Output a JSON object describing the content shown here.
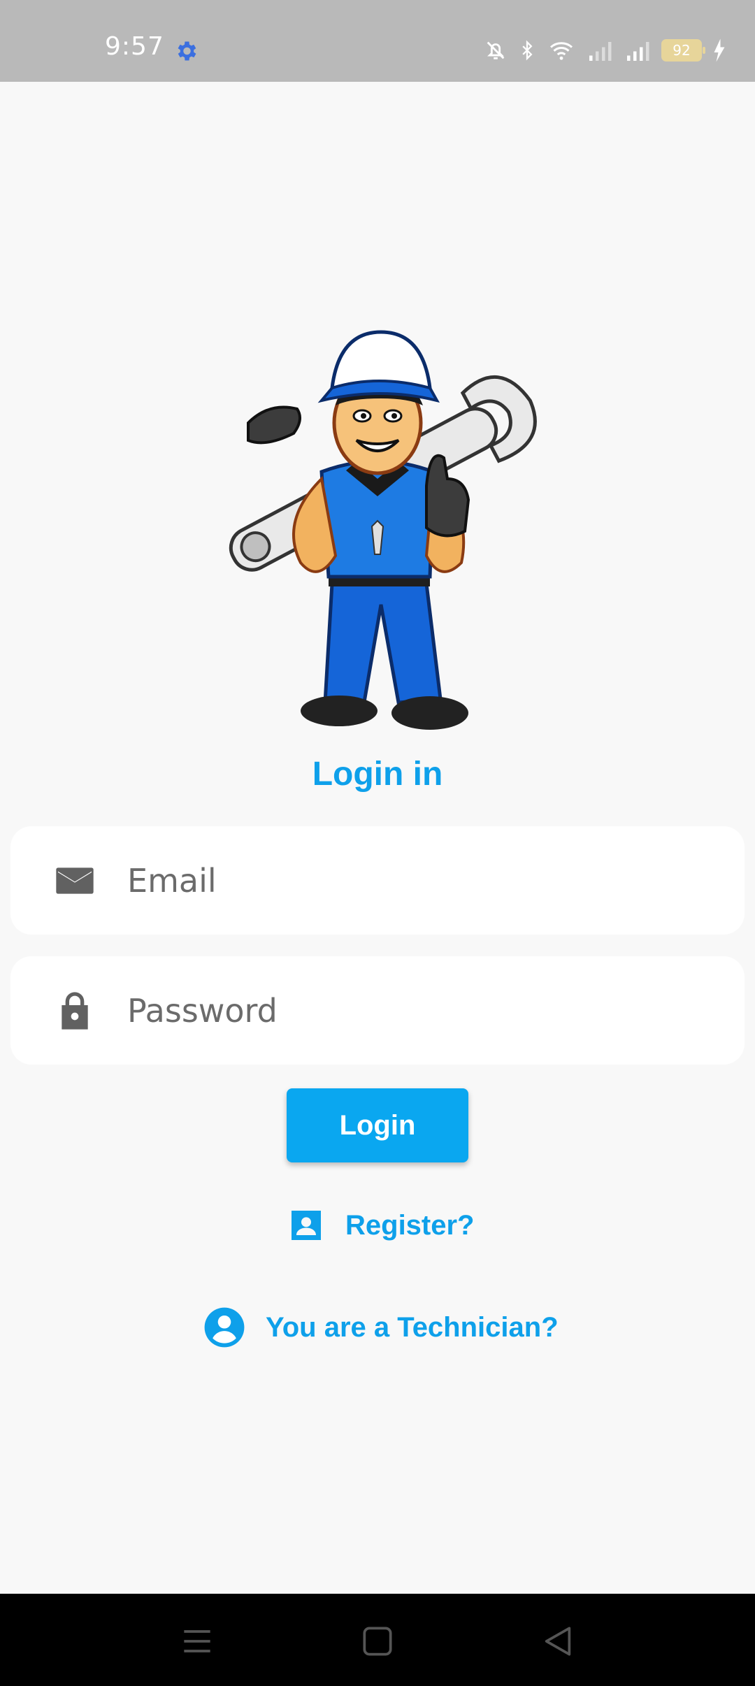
{
  "status_bar": {
    "time": "9:57",
    "battery": "92",
    "icons": [
      "gear-icon",
      "bell-off-icon",
      "bluetooth-icon",
      "wifi-icon",
      "signal-icon",
      "signal-icon",
      "battery-icon",
      "charging-icon"
    ]
  },
  "login": {
    "title": "Login in",
    "email_placeholder": "Email",
    "password_placeholder": "Password",
    "login_button": "Login",
    "register_link": "Register?",
    "technician_link": "You are a Technician?"
  },
  "colors": {
    "accent": "#0ea0ea",
    "button": "#0aa7f0",
    "status_bar": "#b9b9b9"
  },
  "nav_bar": {
    "icons": [
      "menu-icon",
      "home-icon",
      "back-icon"
    ]
  }
}
